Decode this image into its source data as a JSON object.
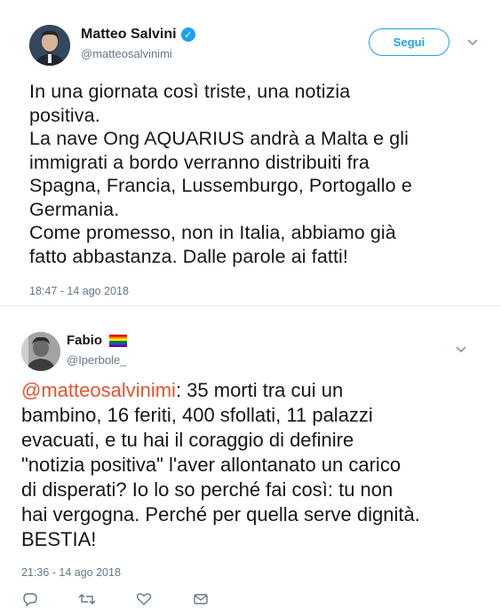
{
  "tweets": [
    {
      "author_name": "Matteo Salvini",
      "verified": true,
      "handle": "@matteosalvinimi",
      "follow_label": "Segui",
      "lines": [
        "In una giornata così triste, una notizia",
        "positiva.",
        "La nave Ong AQUARIUS andrà a Malta e gli",
        "immigrati a bordo verranno distribuiti fra",
        "Spagna, Francia, Lussemburgo, Portogallo e",
        "Germania.",
        "Come promesso, non in Italia, abbiamo già",
        "fatto abbastanza. Dalle parole ai fatti!"
      ],
      "timestamp": "18:47 - 14 ago 2018"
    },
    {
      "author_name": "Fabio",
      "handle": "@Iperbole_",
      "mention": "@matteosalvinimi",
      "first_line_rest": ": 35 morti tra cui un",
      "lines": [
        "bambino, 16 feriti, 400 sfollati, 11 palazzi",
        "evacuati, e tu hai il coraggio di definire",
        "\"notizia positiva\" l'aver allontanato un carico",
        "di disperati? Io lo so perché fai così: tu non",
        "hai vergogna. Perché per quella serve dignità.",
        "BESTIA!"
      ],
      "timestamp": "21:36 - 14 ago 2018"
    }
  ],
  "colors": {
    "mention": "#e0542e",
    "accent": "#1da1f2",
    "secondary_text": "#657786"
  },
  "icons": [
    "verified-badge-icon",
    "chevron-down-icon",
    "reply-icon",
    "retweet-icon",
    "like-icon",
    "dm-icon",
    "rainbow-flag-icon"
  ]
}
